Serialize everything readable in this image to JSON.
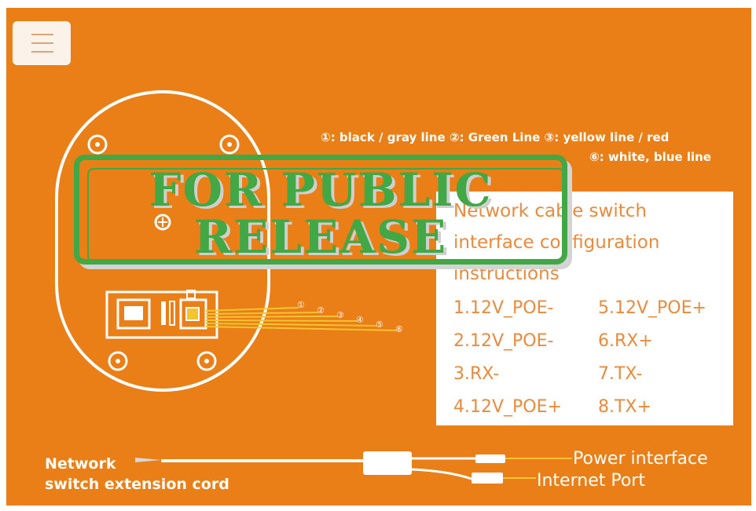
{
  "legend": {
    "line1": "①: black / gray line   ②: Green Line   ③: yellow line / red",
    "line2": "⑥: white, blue line"
  },
  "config_box": {
    "title_line1": "Network cable switch",
    "title_line2": "interface configuration",
    "title_line3": "instructions",
    "pins_left": [
      "1.12V_POE-",
      "2.12V_POE-",
      "3.RX-",
      "4.12V_POE+"
    ],
    "pins_right": [
      "5.12V_POE+",
      "6.RX+",
      "7.TX-",
      "8.TX+"
    ]
  },
  "wire_numbers": [
    "①",
    "②",
    "③",
    "④",
    "⑤",
    "⑥"
  ],
  "cord": {
    "label_line1": "Network",
    "label_line2": "switch extension cord",
    "power_interface": "Power interface",
    "internet_port": "Internet Port"
  },
  "stamp": {
    "line1": "FOR PUBLIC",
    "line2": "RELEASE"
  },
  "colors": {
    "background": "#e97f16",
    "stamp": "#41a845",
    "text_orange": "#e88b3f",
    "wire_yellow": "#f5c431"
  }
}
